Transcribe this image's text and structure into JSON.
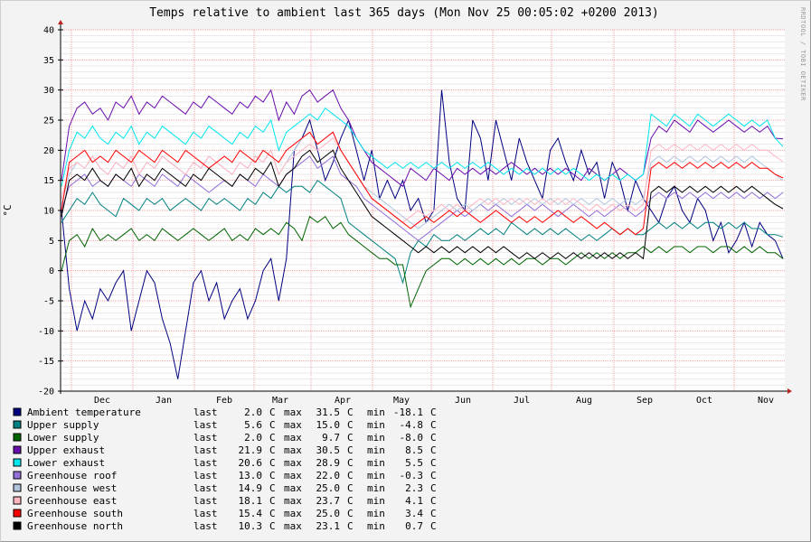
{
  "chart_data": {
    "type": "line",
    "title": "Temps relative to ambient last 365 days (Mon Nov 25 00:05:02 +0200 2013)",
    "ylabel": "°C",
    "watermark": "RRDTOOL / TOBI OETIKER",
    "ylim": [
      -20,
      40
    ],
    "yticks": [
      "40",
      "35",
      "30",
      "25",
      "20",
      "15",
      "10",
      "5",
      "0",
      "-5",
      "-10",
      "-15",
      "-20"
    ],
    "xticks": [
      "Dec",
      "Jan",
      "Feb",
      "Mar",
      "Apr",
      "May",
      "Jun",
      "Jul",
      "Aug",
      "Sep",
      "Oct",
      "Nov"
    ],
    "grid": true,
    "series": [
      {
        "name": "Ambient temperature",
        "color": "#000080",
        "last": "2.0",
        "max": "31.5",
        "min": "-18.1",
        "unit": "C",
        "values": [
          10,
          -3,
          -10,
          -5,
          -8,
          -3,
          -5,
          -2,
          0,
          -10,
          -5,
          0,
          -2,
          -8,
          -12,
          -18,
          -10,
          -2,
          0,
          -5,
          -2,
          -8,
          -5,
          -3,
          -8,
          -5,
          0,
          2,
          -5,
          2,
          20,
          22,
          25,
          20,
          15,
          18,
          22,
          25,
          20,
          15,
          20,
          12,
          15,
          12,
          15,
          10,
          12,
          8,
          10,
          30,
          18,
          12,
          10,
          25,
          22,
          15,
          25,
          20,
          15,
          22,
          18,
          15,
          12,
          20,
          22,
          18,
          15,
          20,
          16,
          18,
          12,
          18,
          15,
          10,
          15,
          12,
          10,
          8,
          12,
          14,
          10,
          8,
          12,
          10,
          5,
          8,
          3,
          5,
          8,
          4,
          8,
          6,
          5,
          2
        ]
      },
      {
        "name": "Upper supply",
        "color": "#008080",
        "last": "5.6",
        "max": "15.0",
        "min": "-4.8",
        "unit": "C",
        "values": [
          8,
          10,
          12,
          11,
          13,
          11,
          10,
          9,
          12,
          11,
          10,
          12,
          11,
          12,
          10,
          11,
          12,
          11,
          10,
          12,
          11,
          12,
          11,
          10,
          12,
          11,
          13,
          12,
          14,
          13,
          14,
          14,
          13,
          15,
          14,
          13,
          12,
          8,
          7,
          6,
          5,
          4,
          3,
          2,
          -2,
          3,
          5,
          4,
          6,
          5,
          5,
          6,
          5,
          6,
          7,
          6,
          7,
          6,
          8,
          7,
          6,
          7,
          6,
          7,
          6,
          7,
          6,
          5,
          6,
          5,
          6,
          7,
          6,
          7,
          6,
          6,
          7,
          8,
          7,
          8,
          7,
          8,
          7,
          8,
          8,
          7,
          8,
          7,
          8,
          7,
          7,
          6,
          6,
          5.6
        ]
      },
      {
        "name": "Lower supply",
        "color": "#006400",
        "last": "2.0",
        "max": "9.7",
        "min": "-8.0",
        "unit": "C",
        "values": [
          0,
          5,
          6,
          4,
          7,
          5,
          6,
          5,
          6,
          7,
          5,
          6,
          5,
          7,
          6,
          5,
          6,
          7,
          6,
          5,
          6,
          7,
          5,
          6,
          5,
          7,
          6,
          7,
          6,
          8,
          7,
          5,
          9,
          8,
          9,
          7,
          8,
          6,
          5,
          4,
          3,
          2,
          2,
          1,
          1,
          -6,
          -3,
          0,
          1,
          2,
          2,
          1,
          2,
          1,
          2,
          1,
          2,
          1,
          2,
          1,
          2,
          2,
          1,
          2,
          2,
          1,
          2,
          3,
          2,
          3,
          2,
          3,
          2,
          3,
          3,
          4,
          3,
          4,
          3,
          4,
          4,
          3,
          4,
          4,
          3,
          4,
          4,
          3,
          4,
          3,
          4,
          3,
          3,
          2
        ]
      },
      {
        "name": "Upper exhaust",
        "color": "#6a0dad",
        "last": "21.9",
        "max": "30.5",
        "min": "8.5",
        "unit": "C",
        "values": [
          15,
          24,
          27,
          28,
          26,
          27,
          25,
          28,
          27,
          29,
          26,
          28,
          27,
          29,
          28,
          27,
          26,
          28,
          27,
          29,
          28,
          27,
          26,
          28,
          27,
          29,
          28,
          30,
          25,
          28,
          26,
          29,
          30,
          28,
          29,
          30,
          27,
          25,
          22,
          20,
          18,
          17,
          16,
          15,
          14,
          17,
          16,
          15,
          17,
          16,
          15,
          17,
          16,
          17,
          16,
          17,
          16,
          17,
          18,
          17,
          16,
          17,
          16,
          17,
          16,
          17,
          16,
          15,
          17,
          16,
          15,
          16,
          17,
          16,
          15,
          16,
          22,
          24,
          23,
          25,
          24,
          23,
          25,
          24,
          23,
          24,
          25,
          24,
          23,
          24,
          23,
          24,
          22,
          21.9
        ]
      },
      {
        "name": "Lower exhaust",
        "color": "#00e5ee",
        "last": "20.6",
        "max": "28.9",
        "min": "5.5",
        "unit": "C",
        "values": [
          14,
          20,
          23,
          22,
          24,
          22,
          21,
          23,
          22,
          24,
          21,
          23,
          22,
          24,
          23,
          22,
          21,
          23,
          22,
          24,
          23,
          22,
          21,
          23,
          22,
          24,
          23,
          25,
          20,
          23,
          24,
          25,
          26,
          25,
          27,
          26,
          25,
          24,
          22,
          20,
          19,
          18,
          17,
          18,
          17,
          18,
          17,
          18,
          17,
          18,
          17,
          18,
          17,
          18,
          17,
          18,
          17,
          16,
          17,
          16,
          17,
          16,
          17,
          16,
          17,
          16,
          17,
          16,
          15,
          16,
          15,
          16,
          15,
          16,
          15,
          16,
          26,
          25,
          24,
          26,
          25,
          24,
          26,
          25,
          24,
          25,
          26,
          25,
          24,
          25,
          24,
          25,
          22,
          20.6
        ]
      },
      {
        "name": "Greenhouse roof",
        "color": "#9370db",
        "last": "13.0",
        "max": "22.0",
        "min": "-0.3",
        "unit": "C",
        "values": [
          10,
          14,
          15,
          16,
          14,
          15,
          14,
          16,
          15,
          14,
          16,
          15,
          14,
          16,
          15,
          14,
          16,
          15,
          14,
          13,
          14,
          15,
          14,
          16,
          15,
          14,
          16,
          15,
          14,
          16,
          17,
          18,
          19,
          17,
          18,
          19,
          16,
          15,
          14,
          12,
          11,
          10,
          9,
          8,
          7,
          6,
          5,
          6,
          7,
          8,
          9,
          10,
          9,
          10,
          11,
          10,
          11,
          10,
          9,
          10,
          11,
          10,
          11,
          10,
          9,
          10,
          11,
          10,
          9,
          10,
          9,
          10,
          11,
          10,
          9,
          10,
          12,
          13,
          12,
          13,
          12,
          13,
          12,
          13,
          12,
          13,
          12,
          13,
          12,
          13,
          12,
          13,
          12,
          13.0
        ]
      },
      {
        "name": "Greenhouse west",
        "color": "#b0c4de",
        "last": "14.9",
        "max": "25.0",
        "min": "2.3",
        "unit": "C",
        "values": [
          11,
          16,
          18,
          17,
          19,
          17,
          16,
          18,
          17,
          19,
          16,
          18,
          17,
          19,
          18,
          17,
          16,
          18,
          17,
          19,
          18,
          17,
          16,
          18,
          17,
          19,
          18,
          20,
          16,
          18,
          20,
          22,
          23,
          21,
          22,
          23,
          20,
          18,
          16,
          14,
          13,
          12,
          11,
          10,
          9,
          8,
          7,
          8,
          9,
          10,
          11,
          10,
          11,
          10,
          11,
          12,
          11,
          12,
          11,
          12,
          11,
          12,
          11,
          12,
          11,
          12,
          11,
          12,
          11,
          12,
          11,
          12,
          11,
          12,
          11,
          12,
          18,
          19,
          18,
          19,
          18,
          19,
          18,
          19,
          18,
          19,
          18,
          19,
          18,
          19,
          18,
          17,
          16,
          14.9
        ]
      },
      {
        "name": "Greenhouse east",
        "color": "#ffb6c1",
        "last": "18.1",
        "max": "23.7",
        "min": "4.1",
        "unit": "C",
        "values": [
          12,
          17,
          18,
          17,
          19,
          17,
          16,
          18,
          17,
          19,
          16,
          18,
          17,
          19,
          18,
          17,
          16,
          18,
          17,
          19,
          18,
          17,
          16,
          18,
          17,
          19,
          18,
          20,
          16,
          18,
          19,
          20,
          21,
          20,
          21,
          22,
          20,
          18,
          16,
          14,
          12,
          11,
          10,
          9,
          8,
          9,
          10,
          9,
          10,
          11,
          10,
          11,
          10,
          11,
          12,
          11,
          12,
          11,
          12,
          11,
          12,
          11,
          12,
          11,
          12,
          11,
          12,
          11,
          10,
          11,
          10,
          11,
          10,
          11,
          10,
          11,
          20,
          21,
          20,
          21,
          20,
          21,
          20,
          21,
          20,
          21,
          20,
          21,
          20,
          21,
          20,
          20,
          19,
          18.1
        ]
      },
      {
        "name": "Greenhouse south",
        "color": "#ff0000",
        "last": "15.4",
        "max": "25.0",
        "min": "3.4",
        "unit": "C",
        "values": [
          10,
          18,
          19,
          20,
          18,
          19,
          18,
          20,
          19,
          18,
          20,
          19,
          18,
          20,
          19,
          18,
          20,
          19,
          18,
          17,
          18,
          19,
          18,
          20,
          19,
          18,
          20,
          19,
          18,
          20,
          21,
          22,
          23,
          21,
          22,
          23,
          20,
          18,
          16,
          14,
          12,
          11,
          10,
          9,
          8,
          7,
          8,
          9,
          8,
          9,
          10,
          9,
          10,
          9,
          8,
          9,
          10,
          9,
          8,
          9,
          8,
          9,
          8,
          9,
          10,
          9,
          8,
          9,
          8,
          7,
          8,
          7,
          6,
          7,
          6,
          7,
          17,
          18,
          17,
          18,
          17,
          18,
          17,
          18,
          17,
          18,
          17,
          18,
          17,
          18,
          17,
          17,
          16,
          15.4
        ]
      },
      {
        "name": "Greenhouse north",
        "color": "#000000",
        "last": "10.3",
        "max": "23.1",
        "min": "0.7",
        "unit": "C",
        "values": [
          9,
          15,
          16,
          15,
          17,
          15,
          14,
          16,
          15,
          17,
          14,
          16,
          15,
          17,
          16,
          15,
          14,
          16,
          15,
          17,
          16,
          15,
          14,
          16,
          15,
          17,
          16,
          18,
          14,
          16,
          17,
          19,
          20,
          18,
          19,
          20,
          17,
          15,
          13,
          11,
          9,
          8,
          7,
          6,
          5,
          4,
          3,
          4,
          3,
          4,
          3,
          4,
          3,
          4,
          3,
          4,
          3,
          4,
          3,
          2,
          3,
          2,
          3,
          2,
          3,
          2,
          3,
          2,
          3,
          2,
          3,
          2,
          3,
          2,
          3,
          2,
          13,
          14,
          13,
          14,
          13,
          14,
          13,
          14,
          13,
          14,
          13,
          14,
          13,
          14,
          13,
          12,
          11,
          10.3
        ]
      }
    ],
    "legend": {
      "placement": "bottom-left",
      "last_label": "last",
      "max_label": "max",
      "min_label": "min"
    }
  }
}
